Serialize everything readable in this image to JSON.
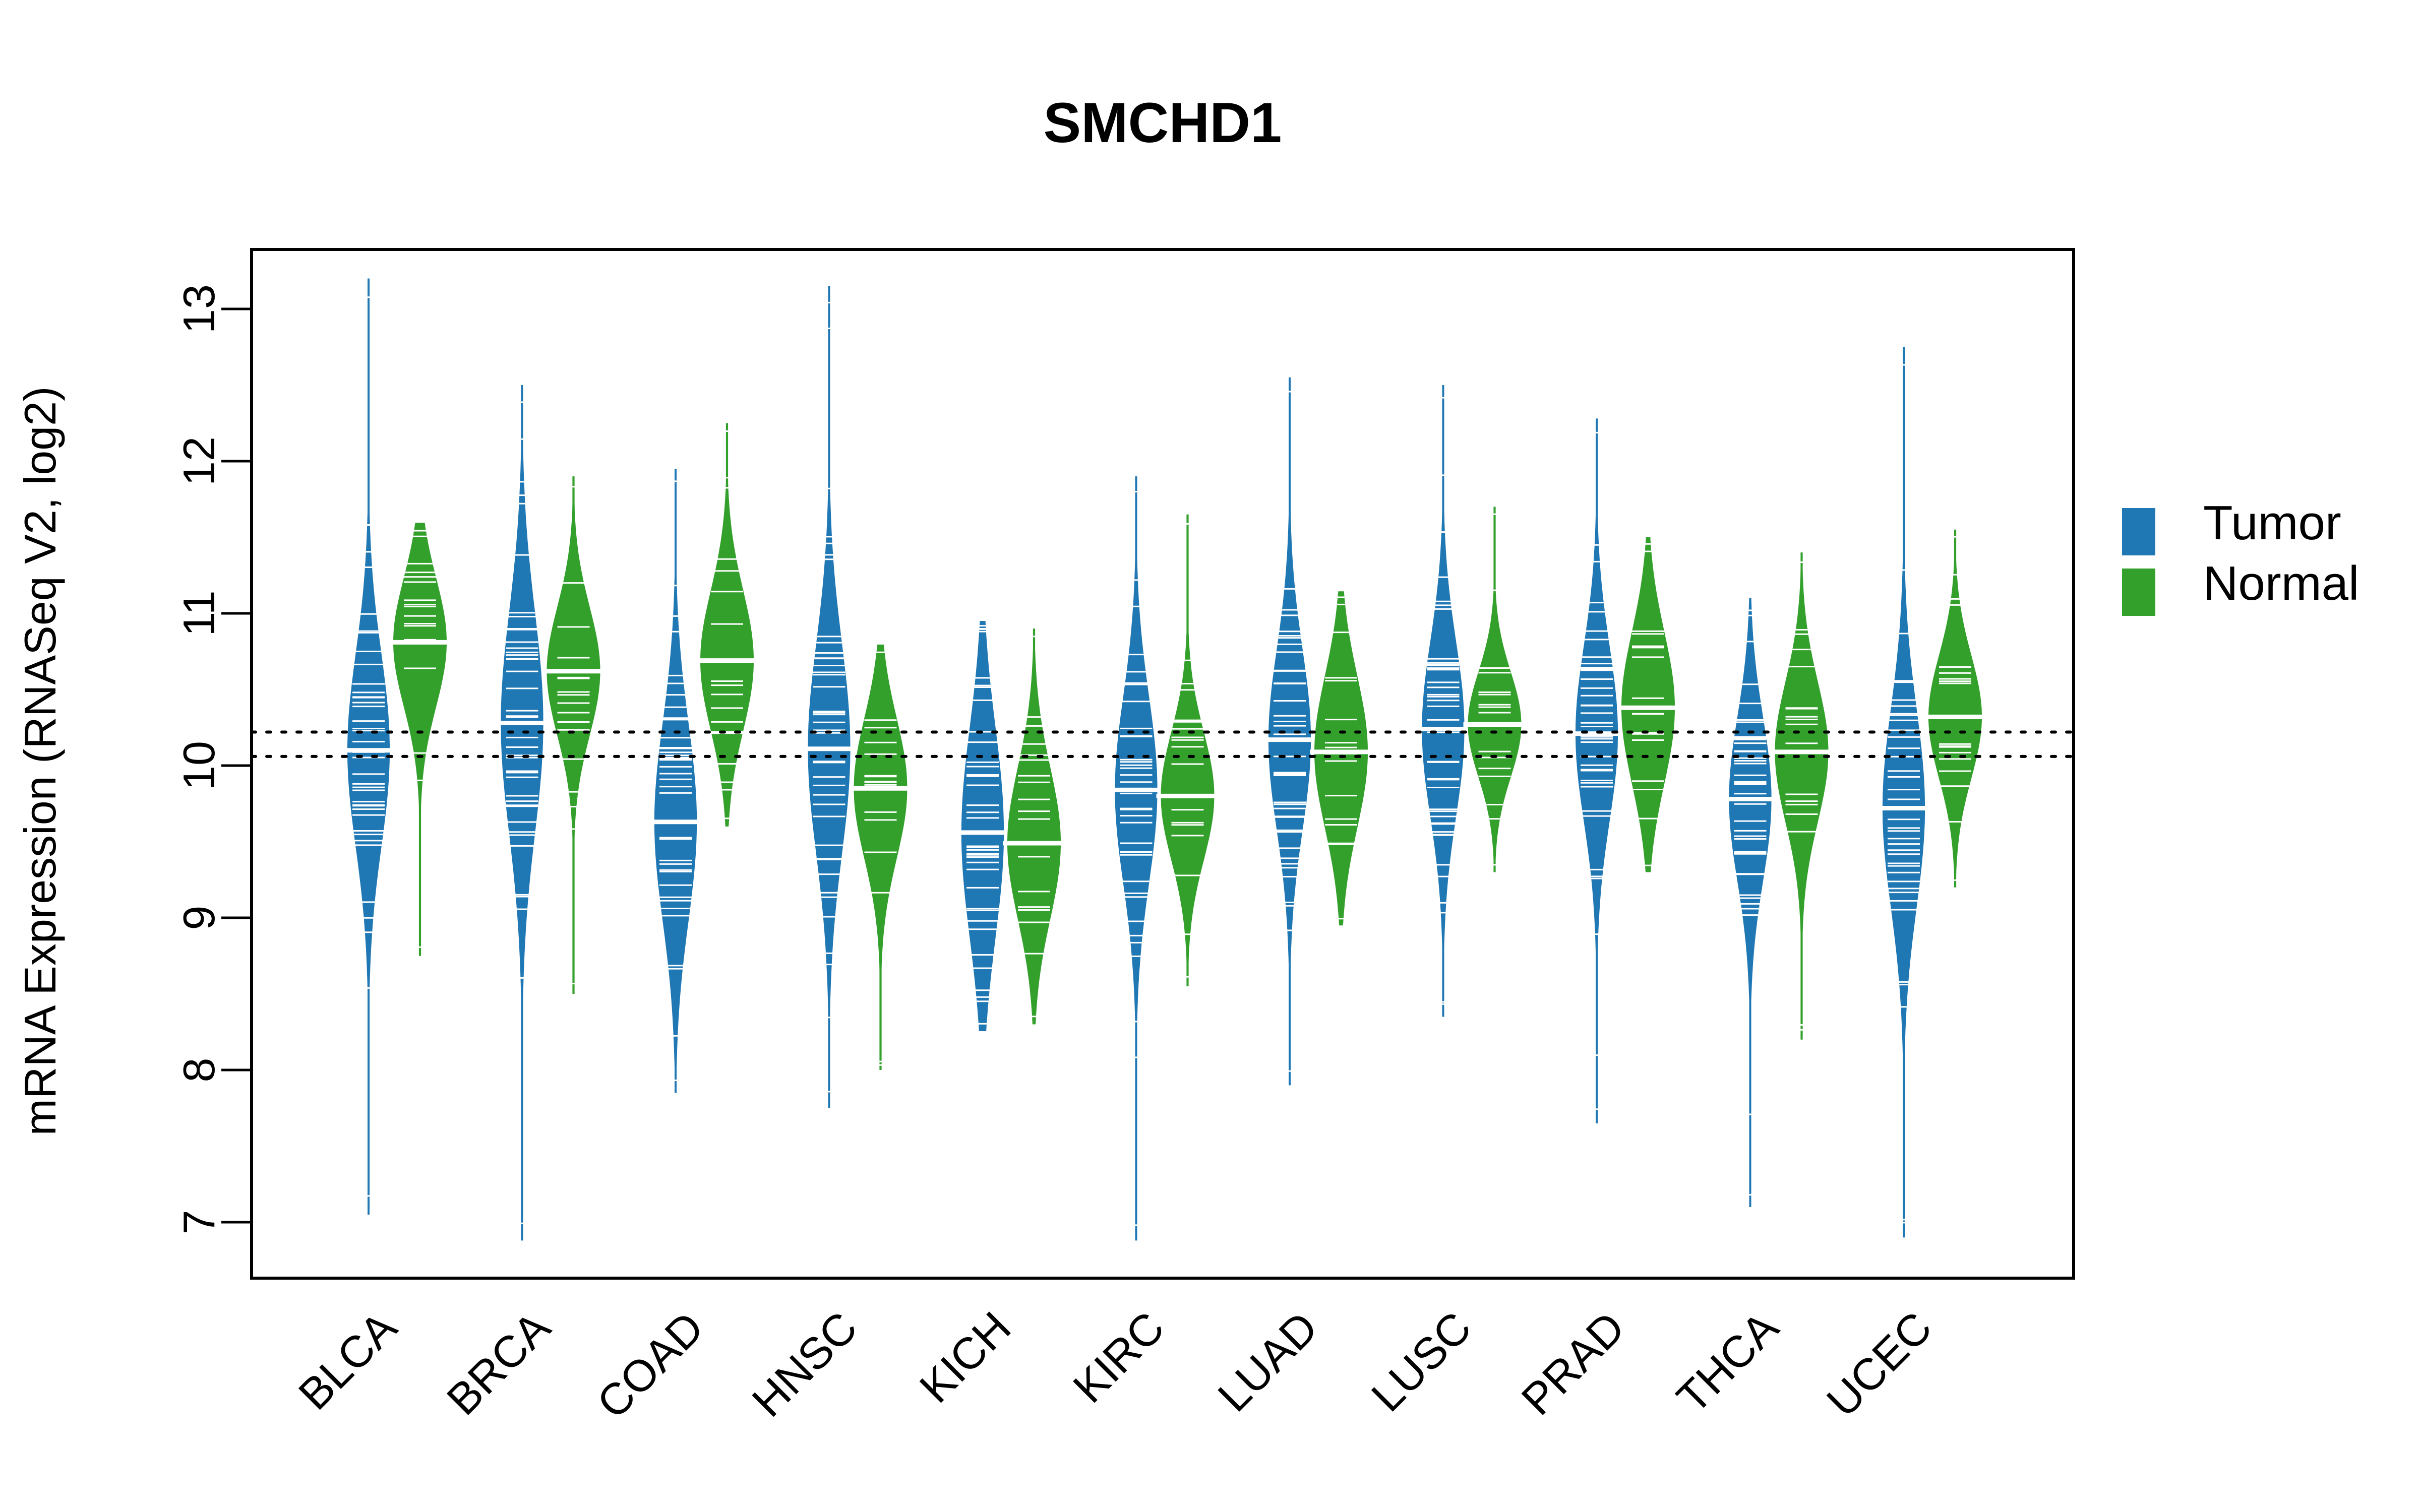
{
  "chart_data": {
    "type": "beanplot",
    "title": "SMCHD1",
    "xlabel": "",
    "ylabel": "mRNA Expression (RNASeq V2, log2)",
    "ylim": [
      6.65,
      13.4
    ],
    "yticks": [
      7,
      8,
      9,
      10,
      11,
      12,
      13
    ],
    "grid": false,
    "categories": [
      "BLCA",
      "BRCA",
      "COAD",
      "HNSC",
      "KICH",
      "KIRC",
      "LUAD",
      "LUSC",
      "PRAD",
      "THCA",
      "UCEC"
    ],
    "reference_lines": [
      10.22,
      10.06
    ],
    "legend": {
      "position": "right",
      "entries": [
        "Tumor",
        "Normal"
      ]
    },
    "colors": {
      "Tumor": "#1f77b4",
      "Normal": "#33a02c"
    },
    "series": [
      {
        "name": "Tumor",
        "median": [
          10.1,
          10.28,
          9.63,
          10.11,
          9.56,
          9.84,
          10.17,
          10.24,
          10.21,
          9.78,
          9.72
        ],
        "min": [
          7.05,
          6.88,
          7.85,
          7.75,
          8.25,
          6.88,
          7.9,
          8.35,
          7.65,
          7.1,
          6.9
        ],
        "max": [
          13.2,
          12.5,
          11.95,
          13.15,
          10.95,
          11.9,
          12.55,
          12.5,
          12.28,
          11.1,
          12.75
        ],
        "body_low": [
          9.3,
          9.3,
          8.8,
          9.2,
          8.7,
          9.1,
          9.4,
          9.5,
          9.5,
          9.1,
          8.9
        ],
        "body_high": [
          10.95,
          11.2,
          10.5,
          11.0,
          10.5,
          10.7,
          10.95,
          11.0,
          11.0,
          10.5,
          10.6
        ]
      },
      {
        "name": "Normal",
        "median": [
          10.81,
          10.62,
          10.69,
          9.85,
          9.49,
          9.8,
          10.09,
          10.27,
          10.38,
          10.09,
          10.32
        ],
        "min": [
          8.75,
          8.5,
          9.6,
          8.0,
          8.3,
          8.55,
          8.95,
          9.3,
          9.3,
          8.2,
          9.2
        ],
        "max": [
          11.6,
          11.9,
          12.25,
          10.8,
          10.9,
          11.65,
          11.15,
          11.7,
          11.5,
          11.4,
          11.55
        ],
        "body_low": [
          10.2,
          10.1,
          10.0,
          9.2,
          8.9,
          9.3,
          9.4,
          9.8,
          9.7,
          9.5,
          9.85
        ],
        "body_high": [
          11.3,
          11.2,
          11.2,
          10.4,
          10.2,
          10.4,
          10.7,
          10.7,
          11.0,
          10.7,
          10.9
        ]
      }
    ]
  }
}
